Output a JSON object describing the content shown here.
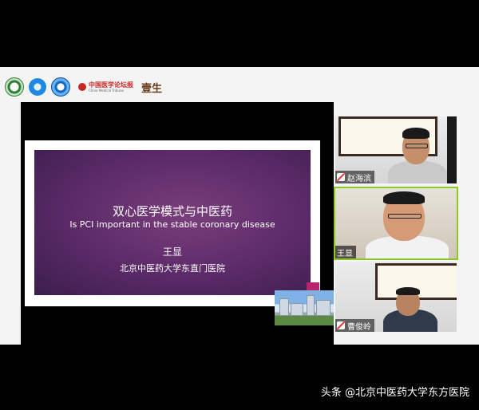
{
  "header": {
    "logos": [
      "hospital-seal-icon",
      "association-emblem-icon",
      "sponsor-cross-icon"
    ],
    "cmt_logo_text": "中国医学论坛报",
    "cmt_logo_subtext": "China Medical Tribune",
    "brand": "壹生"
  },
  "slide": {
    "title_zh": "双心医学模式与中医药",
    "title_en": "Is PCI important in the stable coronary disease",
    "author": "王显",
    "affiliation": "北京中医药大学东直门医院"
  },
  "participants": [
    {
      "name": "赵海滨",
      "mic": "muted"
    },
    {
      "name": "王显",
      "mic": "active"
    },
    {
      "name": "曹俊岭",
      "mic": "muted"
    }
  ],
  "watermark": "头条 @北京中医药大学东方医院",
  "colors": {
    "slide_bg": "#5a2a67",
    "accent": "#b8246e",
    "active_speaker": "#8ac926"
  }
}
